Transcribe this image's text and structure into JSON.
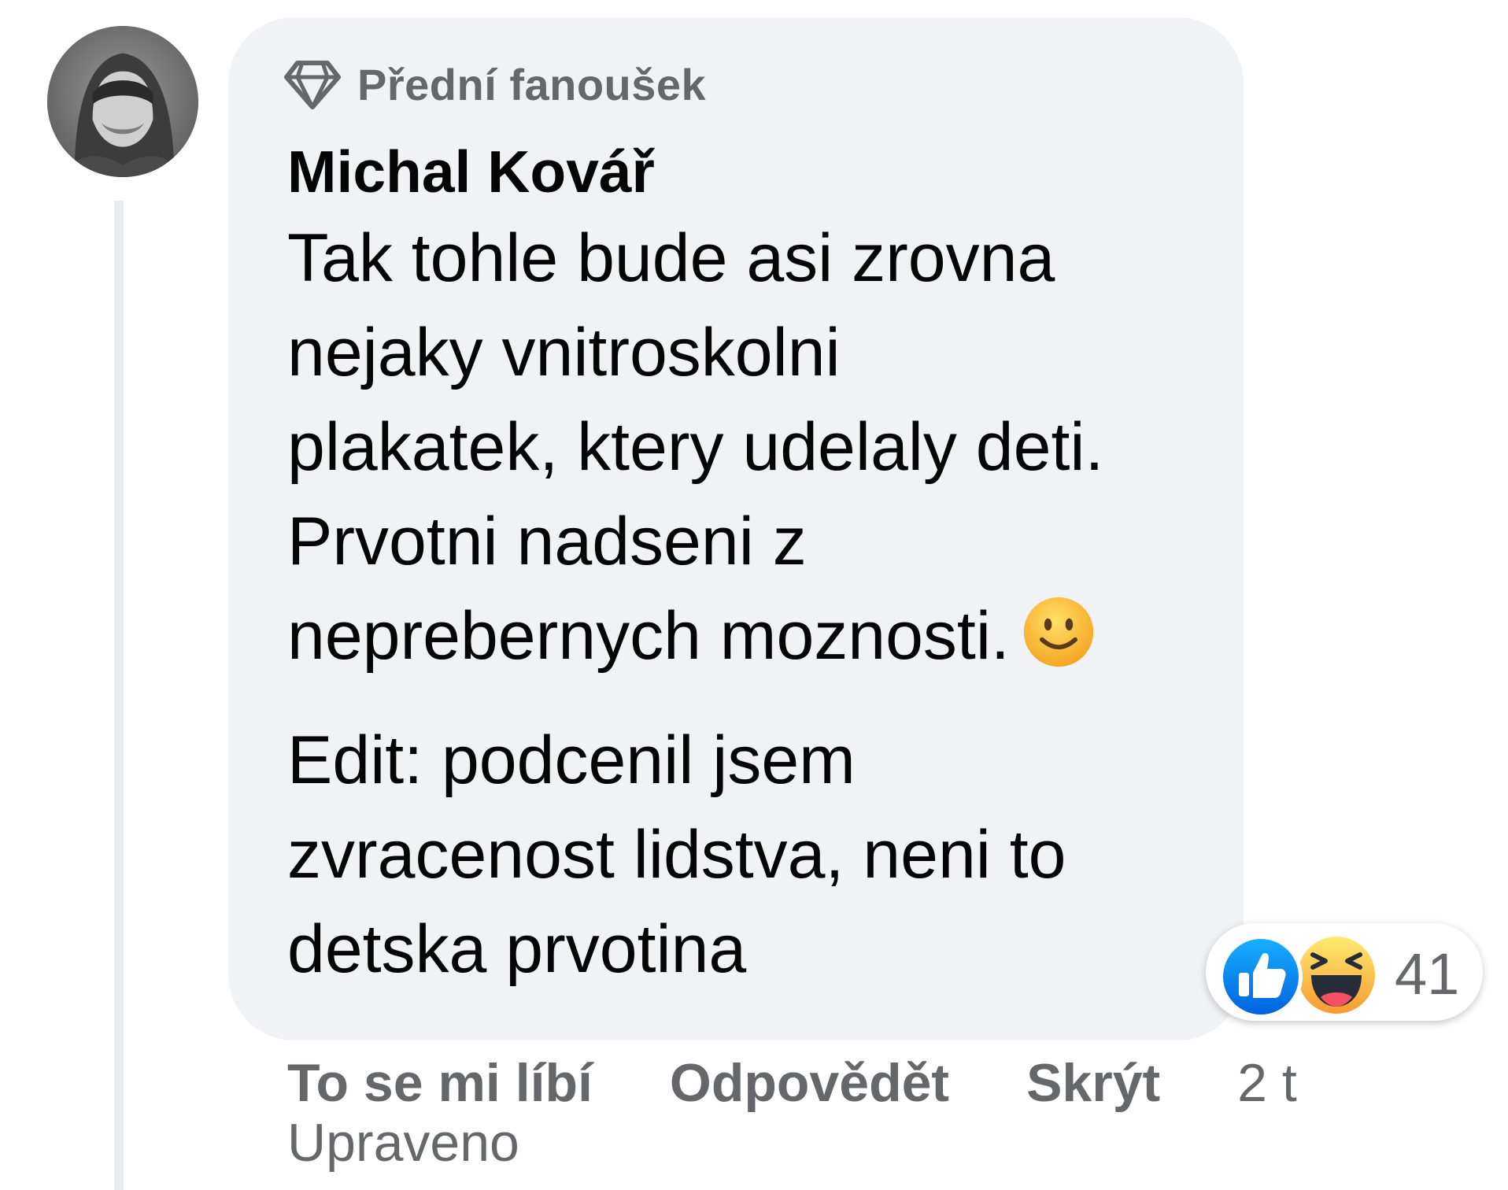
{
  "comment": {
    "badge_label": "Přední fanoušek",
    "badge_icon": "diamond-icon",
    "author": "Michal Kovář",
    "text_lines": [
      "Tak tohle bude asi zrovna",
      "nejaky vnitroskolni",
      "plakatek, ktery udelaly deti.",
      "Prvotni nadseni z",
      "neprebernych moznosti."
    ],
    "inline_emoji": "smiling-face-emoji",
    "edit_lines": [
      "Edit: podcenil jsem",
      "zvracenost lidstva, neni to",
      "detska prvotina"
    ],
    "reactions": {
      "icons": [
        "like-icon",
        "haha-icon"
      ],
      "count": "41"
    },
    "actions": {
      "like": "To se mi líbí",
      "reply": "Odpovědět",
      "hide": "Skrýt",
      "time": "2 t"
    },
    "edited_label": "Upraveno"
  },
  "colors": {
    "bubble": "#f0f2f5",
    "secondary_text": "#65676b",
    "primary_text": "#050505",
    "like_blue": "#1877f2",
    "haha_yellow": "#f7b928"
  }
}
